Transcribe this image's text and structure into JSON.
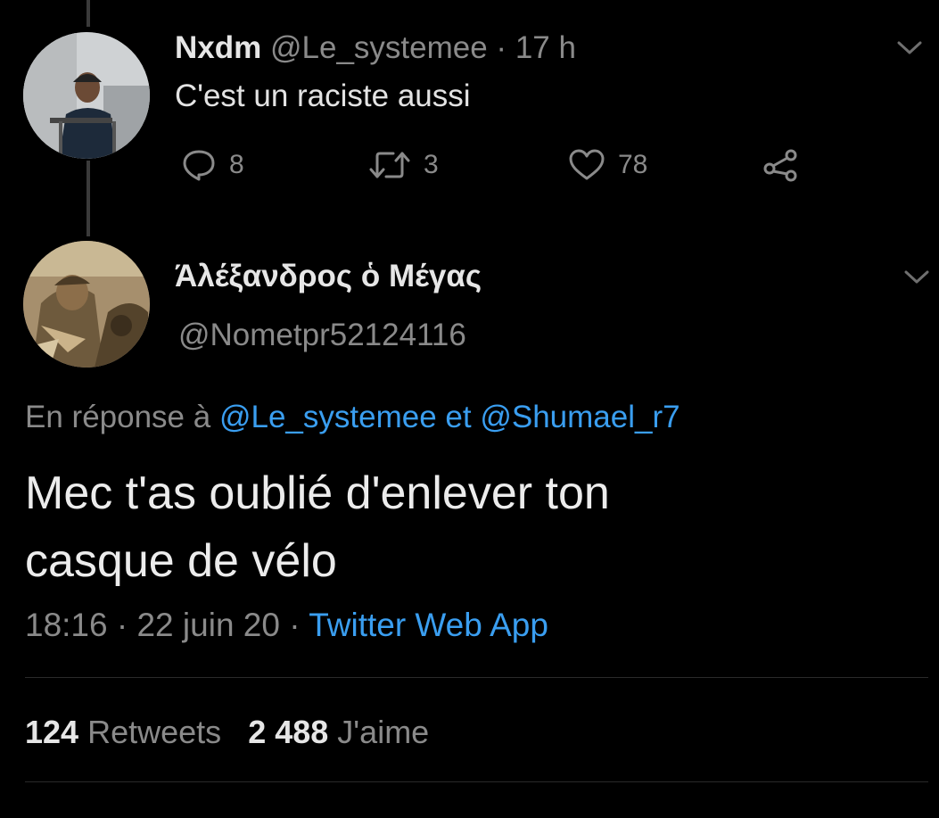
{
  "reply_tweet": {
    "display_name": "Nxdm",
    "handle": "@Le_systemee",
    "separator": "·",
    "time_ago": "17 h",
    "text": "C'est un raciste aussi",
    "actions": {
      "reply_count": "8",
      "retweet_count": "3",
      "like_count": "78"
    }
  },
  "main_tweet": {
    "display_name": "Άλέξανδρος ὁ Μέγας",
    "handle": "@Nometpr52124116",
    "reply_prefix": "En réponse à",
    "reply_user1": "@Le_systemee",
    "reply_and": "et",
    "reply_user2": "@Shumael_r7",
    "text_line1": "Mec t'as oublié d'enlever ton",
    "text_line2": "casque de vélo",
    "time": "18:16",
    "sep1": "·",
    "date": "22 juin 20",
    "sep2": "·",
    "source": "Twitter Web App",
    "retweets_count": "124",
    "retweets_label": "Retweets",
    "likes_count": "2 488",
    "likes_label": "J'aime"
  },
  "colors": {
    "background": "#000000",
    "link": "#3a9ef0",
    "muted": "#8a8a8a"
  }
}
